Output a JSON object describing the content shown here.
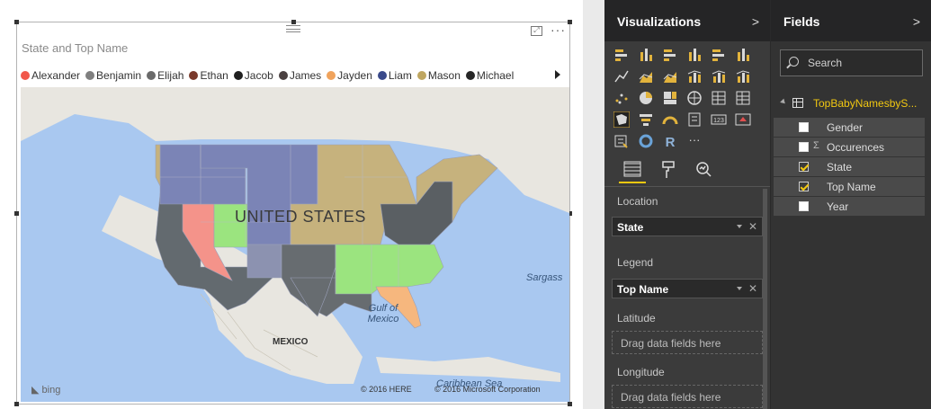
{
  "visual": {
    "title": "State and Top Name",
    "legend": [
      {
        "name": "Alexander",
        "color": "#f1584b"
      },
      {
        "name": "Benjamin",
        "color": "#7f7f7f"
      },
      {
        "name": "Elijah",
        "color": "#6a6a6a"
      },
      {
        "name": "Ethan",
        "color": "#7a3a2c"
      },
      {
        "name": "Jacob",
        "color": "#1f1f1f"
      },
      {
        "name": "James",
        "color": "#4a4040"
      },
      {
        "name": "Jayden",
        "color": "#f0a35c"
      },
      {
        "name": "Liam",
        "color": "#3a4a8a"
      },
      {
        "name": "Mason",
        "color": "#bfa660"
      },
      {
        "name": "Michael",
        "color": "#262626"
      }
    ],
    "state_colors": {
      "west": "#636a6f",
      "nevada": "#f4938a",
      "utah": "#9be47f",
      "northwest": "#7b84b6",
      "plains": "#7b84b6",
      "texas": "#676c70",
      "southwest": "#676c70",
      "colorado": "#8c92b0",
      "midwest": "#c6b27d",
      "southeast": "#9be47f",
      "florida": "#f6b77e",
      "ohio": "#5a5f63",
      "northeast": "#c6b27d"
    },
    "map_labels": {
      "country": "UNITED STATES",
      "gulf": "Gulf of Mexico",
      "mexico": "MEXICO",
      "sargasso": "Sargass",
      "caribbean": "Caribbean Sea",
      "bing": "bing",
      "copyright_here": "© 2016 HERE",
      "copyright_ms": "© 2016 Microsoft Corporation"
    }
  },
  "visualizations": {
    "title": "Visualizations",
    "wells": {
      "location_label": "Location",
      "location_value": "State",
      "legend_label": "Legend",
      "legend_value": "Top Name",
      "latitude_label": "Latitude",
      "latitude_placeholder": "Drag data fields here",
      "longitude_label": "Longitude",
      "longitude_placeholder": "Drag data fields here"
    },
    "r_icon_label": "R",
    "card_icon_label": "123",
    "more_label": "···"
  },
  "fields": {
    "title": "Fields",
    "search_placeholder": "Search",
    "table_name": "TopBabyNamesbyS...",
    "items": [
      {
        "label": "Gender",
        "checked": false,
        "sigma": false
      },
      {
        "label": "Occurences",
        "checked": false,
        "sigma": true
      },
      {
        "label": "State",
        "checked": true,
        "sigma": false
      },
      {
        "label": "Top Name",
        "checked": true,
        "sigma": false
      },
      {
        "label": "Year",
        "checked": false,
        "sigma": false
      }
    ]
  },
  "accent_color": "#f2c811"
}
